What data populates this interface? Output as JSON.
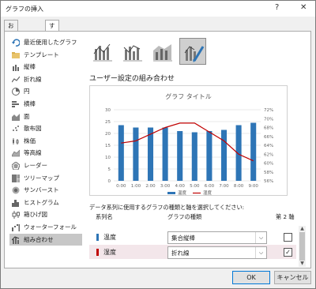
{
  "window": {
    "title": "グラフの挿入",
    "help_glyph": "?",
    "close_glyph": "✕"
  },
  "tabs": [
    {
      "label": "おすすめグラフ",
      "selected": false
    },
    {
      "label": "すべてのグラフ",
      "selected": true
    }
  ],
  "chart_types": [
    {
      "label": "最近使用したグラフ",
      "icon": "recent-icon"
    },
    {
      "label": "テンプレート",
      "icon": "folder-icon"
    },
    {
      "label": "縦棒",
      "icon": "column-chart-icon"
    },
    {
      "label": "折れ線",
      "icon": "line-chart-icon"
    },
    {
      "label": "円",
      "icon": "pie-chart-icon"
    },
    {
      "label": "横棒",
      "icon": "bar-chart-icon"
    },
    {
      "label": "面",
      "icon": "area-chart-icon"
    },
    {
      "label": "散布図",
      "icon": "scatter-chart-icon"
    },
    {
      "label": "株価",
      "icon": "stock-chart-icon"
    },
    {
      "label": "等高線",
      "icon": "surface-chart-icon"
    },
    {
      "label": "レーダー",
      "icon": "radar-chart-icon"
    },
    {
      "label": "ツリーマップ",
      "icon": "treemap-chart-icon"
    },
    {
      "label": "サンバースト",
      "icon": "sunburst-chart-icon"
    },
    {
      "label": "ヒストグラム",
      "icon": "histogram-chart-icon"
    },
    {
      "label": "箱ひげ図",
      "icon": "boxwhisker-chart-icon"
    },
    {
      "label": "ウォーターフォール",
      "icon": "waterfall-chart-icon"
    },
    {
      "label": "組み合わせ",
      "icon": "combo-chart-icon",
      "selected": true
    }
  ],
  "subtypes": [
    {
      "icon": "clustered-column-line-icon",
      "selected": false
    },
    {
      "icon": "clustered-column-line-secondary-icon",
      "selected": false
    },
    {
      "icon": "stacked-area-column-icon",
      "selected": false
    },
    {
      "icon": "custom-combination-icon",
      "selected": true
    }
  ],
  "section_title": "ユーザー設定の組み合わせ",
  "chart_data": {
    "type": "bar",
    "title": "グラフ タイトル",
    "categories": [
      "0:00",
      "1:00",
      "2:00",
      "3:00",
      "4:00",
      "5:00",
      "6:00",
      "7:00",
      "8:00",
      "9:00"
    ],
    "series": [
      {
        "name": "温度",
        "type": "bar",
        "axis": "primary",
        "color": "#2e75b6",
        "values": [
          23.5,
          22.5,
          22.5,
          22.5,
          21,
          20.5,
          21,
          21.5,
          23.5,
          24.5
        ]
      },
      {
        "name": "湿度",
        "type": "line",
        "axis": "secondary",
        "color": "#c00000",
        "values": [
          64.5,
          65,
          66.5,
          68,
          69,
          69,
          67,
          65,
          62,
          60.5
        ]
      }
    ],
    "ylim_primary": [
      0,
      30
    ],
    "yticks_primary": [
      "0",
      "5",
      "10",
      "15",
      "20",
      "25",
      "30"
    ],
    "ylim_secondary": [
      56,
      72
    ],
    "yticks_secondary": [
      "56%",
      "58%",
      "60%",
      "62%",
      "64%",
      "66%",
      "68%",
      "70%",
      "72%"
    ],
    "legend_position": "bottom"
  },
  "series_panel": {
    "description": "データ系列に使用するグラフの種類と軸を選択してください:",
    "header_series": "系列名",
    "header_type": "グラフの種類",
    "header_axis": "第 2 軸",
    "rows": [
      {
        "name": "温度",
        "color": "#2e75b6",
        "type": "集合縦棒",
        "secondary_axis": false,
        "checkmark": ""
      },
      {
        "name": "湿度",
        "color": "#c00000",
        "type": "折れ線",
        "secondary_axis": true,
        "checkmark": "✓"
      }
    ]
  },
  "buttons": {
    "ok": "OK",
    "cancel": "キャンセル"
  }
}
